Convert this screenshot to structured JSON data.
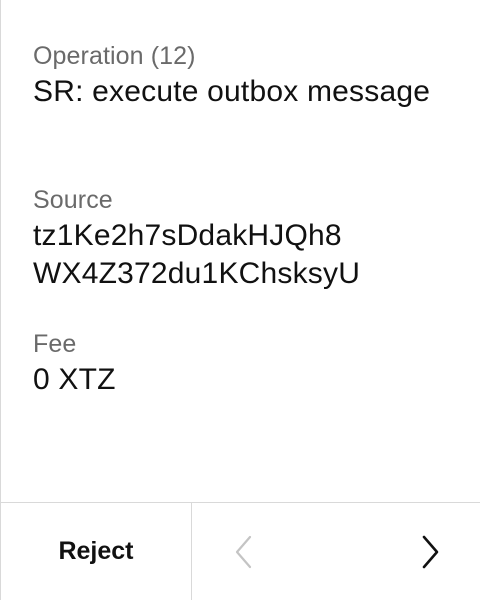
{
  "fields": [
    {
      "label": "Operation (12)",
      "value_lines": [
        "SR: execute outbox",
        "message"
      ]
    },
    {
      "label": "Source",
      "value_lines": [
        "tz1Ke2h7sDdakHJQh8",
        "WX4Z372du1KChsksyU"
      ]
    },
    {
      "label": "Fee",
      "value_lines": [
        "0 XTZ"
      ]
    }
  ],
  "footer": {
    "reject_label": "Reject",
    "prev_icon": "chevron-left-icon",
    "next_icon": "chevron-right-icon",
    "prev_enabled": false,
    "next_enabled": true
  },
  "colors": {
    "label": "#6a6a6a",
    "value": "#111111",
    "divider": "#d9d9d9",
    "disabled_icon": "#c4c4c4"
  }
}
